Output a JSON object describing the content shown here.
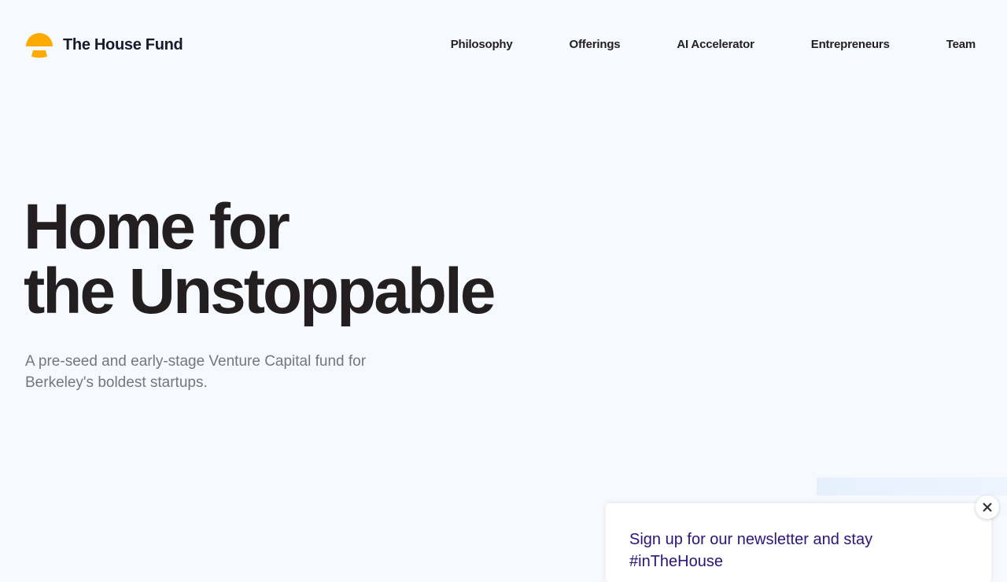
{
  "brand": {
    "name": "The House Fund",
    "accent": "#ffaa00"
  },
  "nav": {
    "items": [
      {
        "label": "Philosophy"
      },
      {
        "label": "Offerings"
      },
      {
        "label": "AI Accelerator"
      },
      {
        "label": "Entrepreneurs"
      },
      {
        "label": "Team"
      }
    ]
  },
  "hero": {
    "title_line1": "Home for",
    "title_line2": "the Unstoppable",
    "subtitle": "A pre-seed and early-stage Venture Capital fund for Berkeley's boldest startups."
  },
  "popup": {
    "title": "Sign up for our newsletter and stay #inTheHouse",
    "title_color": "#2b1577",
    "close_icon": "close-icon"
  }
}
